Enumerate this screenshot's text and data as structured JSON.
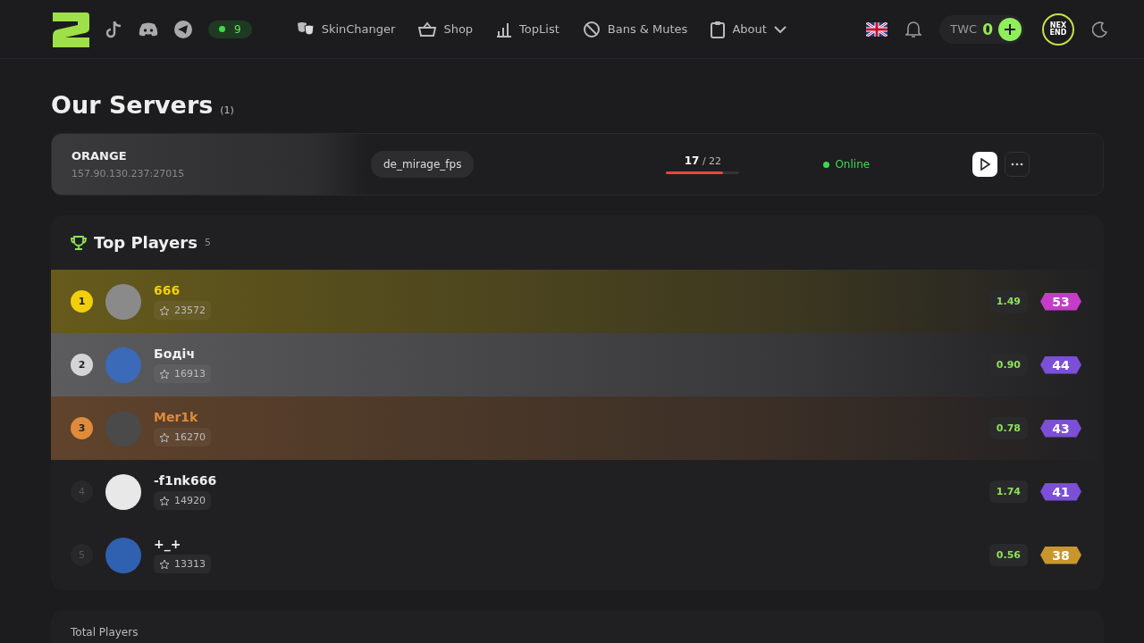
{
  "header": {
    "online_count": "9",
    "nav": [
      {
        "label": "SkinChanger",
        "kind": "masks",
        "has_menu": false
      },
      {
        "label": "Shop",
        "kind": "basket",
        "has_menu": false
      },
      {
        "label": "TopList",
        "kind": "bars",
        "has_menu": false
      },
      {
        "label": "Bans & Mutes",
        "kind": "ban",
        "has_menu": false
      },
      {
        "label": "About",
        "kind": "clipboard",
        "has_menu": true
      }
    ],
    "currency": "TWC",
    "balance": "0",
    "avatar_text": [
      "NEX",
      "END"
    ]
  },
  "title": "Our Servers",
  "server_count": "(1)",
  "servers": [
    {
      "name": "ORANGE",
      "address": "157.90.130.237:27015",
      "map": "de_mirage_fps",
      "players": "17",
      "max_players": "/ 22",
      "level": 0.77,
      "status": "Online",
      "online": true
    }
  ],
  "top_players": {
    "title": "Top Players",
    "count": "5",
    "players": [
      {
        "rank": "1",
        "name": "666",
        "points": "23572",
        "kd": "1.49",
        "level_badge": {
          "text": "53",
          "color": "#c43cc8"
        },
        "color": "#f2cf0c"
      },
      {
        "rank": "2",
        "name": "Бодіч",
        "points": "16913",
        "kd": "0.90",
        "level_badge": {
          "text": "44",
          "color": "#7b4fd6"
        },
        "color": "#d4d4d4"
      },
      {
        "rank": "3",
        "name": "Mer1k",
        "points": "16270",
        "kd": "0.78",
        "level_badge": {
          "text": "43",
          "color": "#7b4fd6"
        },
        "color": "#e08a3c"
      },
      {
        "rank": "4",
        "name": "-f1nk666",
        "points": "14920",
        "kd": "1.74",
        "level_badge": {
          "text": "41",
          "color": "#7b4fd6"
        }
      },
      {
        "rank": "5",
        "name": "+_+",
        "points": "13313",
        "kd": "0.56",
        "level_badge": {
          "text": "38",
          "color": "#c8962e"
        }
      }
    ]
  },
  "total_players": {
    "label": "Total Players"
  }
}
